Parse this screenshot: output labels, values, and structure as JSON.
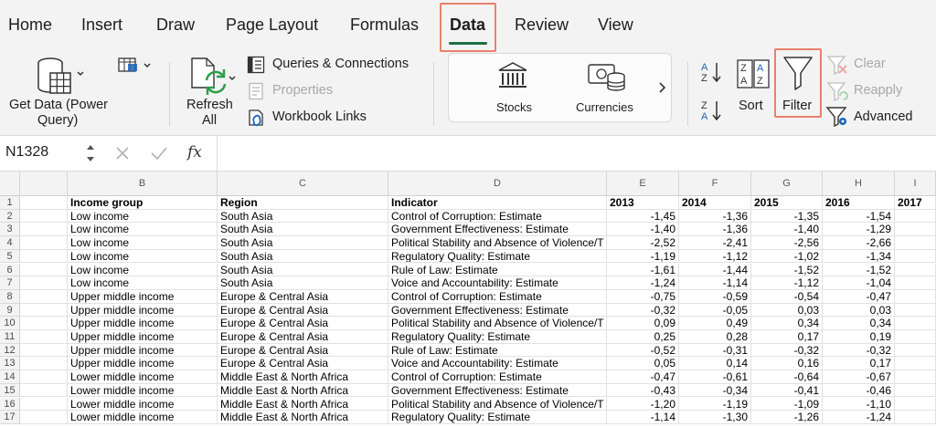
{
  "tabs": [
    "Home",
    "Insert",
    "Draw",
    "Page Layout",
    "Formulas",
    "Data",
    "Review",
    "View"
  ],
  "active_tab": "Data",
  "ribbon": {
    "get_data_line1": "Get Data (Power",
    "get_data_line2": "Query)",
    "refresh_line1": "Refresh",
    "refresh_line2": "All",
    "queries_connections": "Queries & Connections",
    "properties": "Properties",
    "workbook_links": "Workbook Links",
    "stocks": "Stocks",
    "currencies": "Currencies",
    "sort": "Sort",
    "filter": "Filter",
    "clear": "Clear",
    "reapply": "Reapply",
    "advanced": "Advanced"
  },
  "icons": {
    "get_data": "database-icon",
    "table_dropdown": "table-image-icon",
    "refresh": "refresh-icon",
    "queries": "queries-icon",
    "properties": "properties-icon",
    "links": "link-icon",
    "stocks": "bank-icon",
    "currencies": "currency-icon",
    "sort_az": "sort-ascending-icon",
    "sort_za": "sort-descending-icon",
    "sort": "sort-icon",
    "filter": "funnel-icon",
    "clear": "clear-filter-icon",
    "reapply": "reapply-filter-icon",
    "advanced": "advanced-filter-icon"
  },
  "colors": {
    "accent_green": "#1e7145",
    "highlight": "#e8806b",
    "ribbon_bg": "#f3f3f3",
    "icon_blue": "#1a63b8"
  },
  "formula_bar": {
    "name_box": "N1328",
    "fx": "fx",
    "formula": ""
  },
  "sheet": {
    "columns": [
      "",
      "B",
      "C",
      "D",
      "E",
      "F",
      "G",
      "H",
      "I"
    ],
    "rows": [
      {
        "n": "1",
        "cells": [
          "",
          "Income group",
          "Region",
          "Indicator",
          "2013",
          "2014",
          "2015",
          "2016",
          "2017"
        ]
      },
      {
        "n": "2",
        "cells": [
          "",
          "Low income",
          "South Asia",
          "Control of Corruption: Estimate",
          "-1,45",
          "-1,36",
          "-1,35",
          "-1,54",
          ""
        ]
      },
      {
        "n": "3",
        "cells": [
          "",
          "Low income",
          "South Asia",
          "Government Effectiveness: Estimate",
          "-1,40",
          "-1,36",
          "-1,40",
          "-1,29",
          ""
        ]
      },
      {
        "n": "4",
        "cells": [
          "",
          "Low income",
          "South Asia",
          "Political Stability and Absence of Violence/T",
          "-2,52",
          "-2,41",
          "-2,56",
          "-2,66",
          ""
        ]
      },
      {
        "n": "5",
        "cells": [
          "",
          "Low income",
          "South Asia",
          "Regulatory Quality: Estimate",
          "-1,19",
          "-1,12",
          "-1,02",
          "-1,34",
          ""
        ]
      },
      {
        "n": "6",
        "cells": [
          "",
          "Low income",
          "South Asia",
          "Rule of Law: Estimate",
          "-1,61",
          "-1,44",
          "-1,52",
          "-1,52",
          ""
        ]
      },
      {
        "n": "7",
        "cells": [
          "",
          "Low income",
          "South Asia",
          "Voice and Accountability: Estimate",
          "-1,24",
          "-1,14",
          "-1,12",
          "-1,04",
          ""
        ]
      },
      {
        "n": "8",
        "cells": [
          "",
          "Upper middle income",
          "Europe & Central Asia",
          "Control of Corruption: Estimate",
          "-0,75",
          "-0,59",
          "-0,54",
          "-0,47",
          ""
        ]
      },
      {
        "n": "9",
        "cells": [
          "",
          "Upper middle income",
          "Europe & Central Asia",
          "Government Effectiveness: Estimate",
          "-0,32",
          "-0,05",
          "0,03",
          "0,03",
          ""
        ]
      },
      {
        "n": "10",
        "cells": [
          "",
          "Upper middle income",
          "Europe & Central Asia",
          "Political Stability and Absence of Violence/T",
          "0,09",
          "0,49",
          "0,34",
          "0,34",
          ""
        ]
      },
      {
        "n": "11",
        "cells": [
          "",
          "Upper middle income",
          "Europe & Central Asia",
          "Regulatory Quality: Estimate",
          "0,25",
          "0,28",
          "0,17",
          "0,19",
          ""
        ]
      },
      {
        "n": "12",
        "cells": [
          "",
          "Upper middle income",
          "Europe & Central Asia",
          "Rule of Law: Estimate",
          "-0,52",
          "-0,31",
          "-0,32",
          "-0,32",
          ""
        ]
      },
      {
        "n": "13",
        "cells": [
          "",
          "Upper middle income",
          "Europe & Central Asia",
          "Voice and Accountability: Estimate",
          "0,05",
          "0,14",
          "0,16",
          "0,17",
          ""
        ]
      },
      {
        "n": "14",
        "cells": [
          "",
          "Lower middle income",
          "Middle East & North Africa",
          "Control of Corruption: Estimate",
          "-0,47",
          "-0,61",
          "-0,64",
          "-0,67",
          ""
        ]
      },
      {
        "n": "15",
        "cells": [
          "",
          "Lower middle income",
          "Middle East & North Africa",
          "Government Effectiveness: Estimate",
          "-0,43",
          "-0,34",
          "-0,41",
          "-0,46",
          ""
        ]
      },
      {
        "n": "16",
        "cells": [
          "",
          "Lower middle income",
          "Middle East & North Africa",
          "Political Stability and Absence of Violence/T",
          "-1,20",
          "-1,19",
          "-1,09",
          "-1,10",
          ""
        ]
      },
      {
        "n": "17",
        "cells": [
          "",
          "Lower middle income",
          "Middle East & North Africa",
          "Regulatory Quality: Estimate",
          "-1,14",
          "-1,30",
          "-1,26",
          "-1,24",
          ""
        ]
      }
    ]
  }
}
